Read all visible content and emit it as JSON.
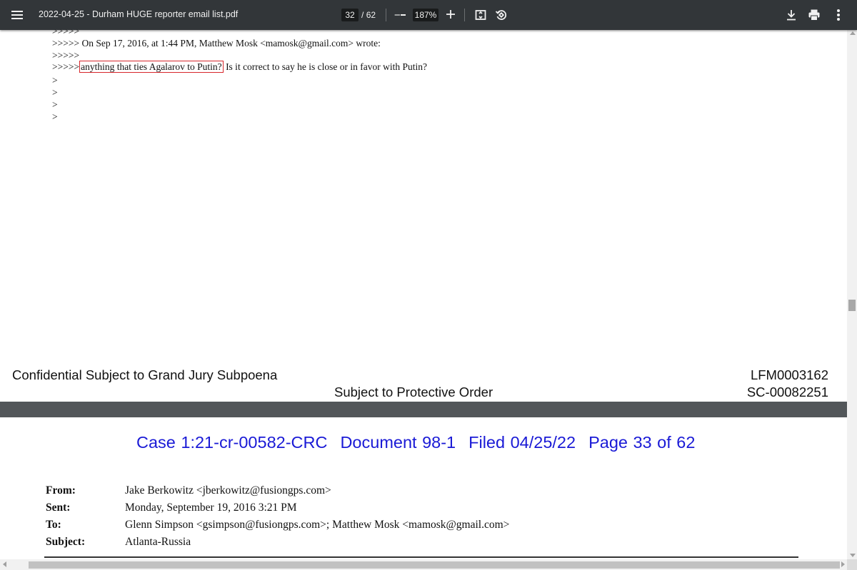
{
  "toolbar": {
    "title": "2022-04-25 - Durham HUGE reporter email list.pdf",
    "current_page": "32",
    "page_separator": "/",
    "total_pages": "62",
    "zoom": "187%",
    "icons": [
      "menu-icon",
      "minus-icon",
      "plus-icon",
      "fit-to-page-icon",
      "rotate-icon",
      "download-icon",
      "print-icon",
      "more-vert-icon"
    ]
  },
  "page_upper": {
    "email_lines": {
      "l0": ">>>>>",
      "l1": ">>>>> On Sep 17, 2016, at 1:44 PM, Matthew Mosk <mamosk@gmail.com> wrote:",
      "l2": ">>>>>",
      "l3_prefix": ">>>>>",
      "l3_highlight": "anything that ties Agalarov to Putin?",
      "l3_rest": " Is it correct to say he is close or in favor with Putin?",
      "l4": ">",
      "l5": ">",
      "l6": ">",
      "l7": ">"
    },
    "highlight_color": "#d7262b",
    "footer": {
      "confidential": "Confidential Subject to Grand Jury Subpoena",
      "protective": "Subject to Protective Order",
      "bates_1": "LFM0003162",
      "bates_2": "SC-00082251"
    }
  },
  "page_lower": {
    "case_header": {
      "case": "Case 1:21-cr-00582-CRC",
      "document": "Document 98-1",
      "filed": "Filed 04/25/22",
      "page": "Page 33 of 62",
      "color": "#1a1ad6"
    },
    "email_header": {
      "from_label": "From:",
      "from_value": "Jake Berkowitz <jberkowitz@fusiongps.com>",
      "sent_label": "Sent:",
      "sent_value": "Monday, September 19, 2016 3:21 PM",
      "to_label": "To:",
      "to_value": "Glenn Simpson <gsimpson@fusiongps.com>; Matthew Mosk <mamosk@gmail.com>",
      "subject_label": "Subject:",
      "subject_value": "Atlanta-Russia"
    }
  }
}
